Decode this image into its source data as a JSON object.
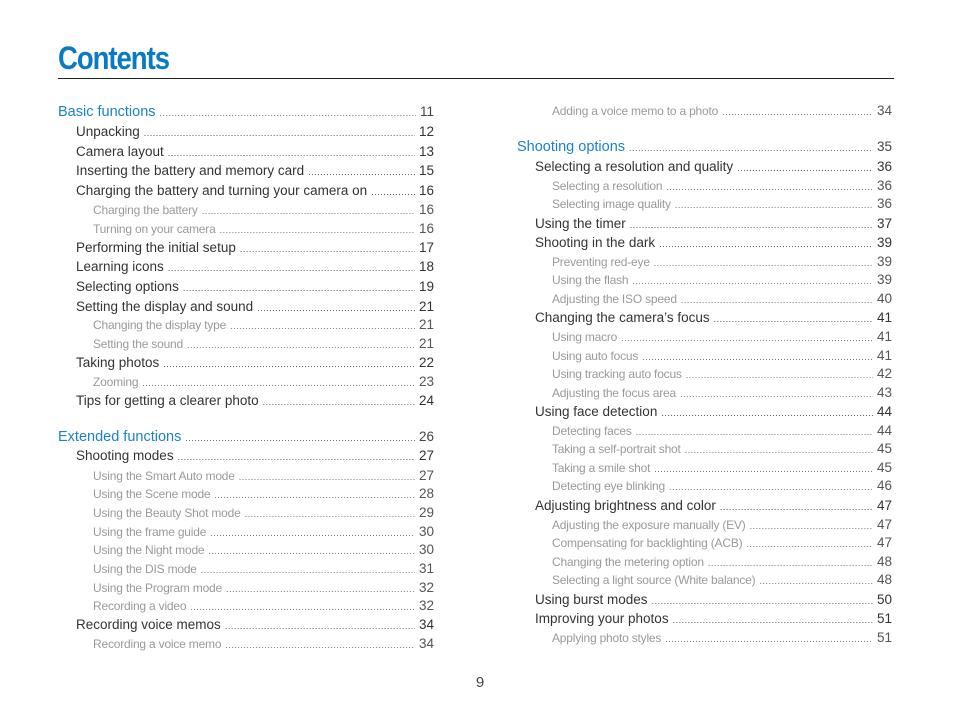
{
  "document": {
    "title": "Contents",
    "page_number": "9",
    "accent_color": "#1a82c8"
  },
  "toc": {
    "left": [
      {
        "level": 1,
        "label": "Basic functions",
        "page": "11"
      },
      {
        "level": 2,
        "label": "Unpacking",
        "page": "12"
      },
      {
        "level": 2,
        "label": "Camera layout",
        "page": "13"
      },
      {
        "level": 2,
        "label": "Inserting the battery and memory card",
        "page": "15"
      },
      {
        "level": 2,
        "label": "Charging the battery and turning your camera on",
        "page": "16"
      },
      {
        "level": 3,
        "label": "Charging the battery",
        "page": "16"
      },
      {
        "level": 3,
        "label": "Turning on your camera",
        "page": "16"
      },
      {
        "level": 2,
        "label": "Performing the initial setup",
        "page": "17"
      },
      {
        "level": 2,
        "label": "Learning icons",
        "page": "18"
      },
      {
        "level": 2,
        "label": "Selecting options",
        "page": "19"
      },
      {
        "level": 2,
        "label": "Setting the display and sound",
        "page": "21"
      },
      {
        "level": 3,
        "label": "Changing the display type",
        "page": "21"
      },
      {
        "level": 3,
        "label": "Setting the sound",
        "page": "21"
      },
      {
        "level": 2,
        "label": "Taking photos",
        "page": "22"
      },
      {
        "level": 3,
        "label": "Zooming",
        "page": "23"
      },
      {
        "level": 2,
        "label": "Tips for getting a clearer photo",
        "page": "24"
      },
      {
        "level": 1,
        "label": "Extended functions",
        "page": "26"
      },
      {
        "level": 2,
        "label": "Shooting modes",
        "page": "27"
      },
      {
        "level": 3,
        "label": "Using the Smart Auto mode",
        "page": "27"
      },
      {
        "level": 3,
        "label": "Using the Scene mode",
        "page": "28"
      },
      {
        "level": 3,
        "label": "Using the Beauty Shot mode",
        "page": "29"
      },
      {
        "level": 3,
        "label": "Using the frame guide",
        "page": "30"
      },
      {
        "level": 3,
        "label": "Using the Night mode",
        "page": "30"
      },
      {
        "level": 3,
        "label": "Using the DIS mode",
        "page": "31"
      },
      {
        "level": 3,
        "label": "Using the Program mode",
        "page": "32"
      },
      {
        "level": 3,
        "label": "Recording a video",
        "page": "32"
      },
      {
        "level": 2,
        "label": "Recording voice memos",
        "page": "34"
      },
      {
        "level": 3,
        "label": "Recording a voice memo",
        "page": "34"
      }
    ],
    "right": [
      {
        "level": 3,
        "label": "Adding a voice memo to a photo",
        "page": "34"
      },
      {
        "level": 1,
        "label": "Shooting options",
        "page": "35"
      },
      {
        "level": 2,
        "label": "Selecting a resolution and quality",
        "page": "36"
      },
      {
        "level": 3,
        "label": "Selecting a resolution",
        "page": "36"
      },
      {
        "level": 3,
        "label": "Selecting image quality",
        "page": "36"
      },
      {
        "level": 2,
        "label": "Using the timer",
        "page": "37"
      },
      {
        "level": 2,
        "label": "Shooting in the dark",
        "page": "39"
      },
      {
        "level": 3,
        "label": "Preventing red-eye",
        "page": "39"
      },
      {
        "level": 3,
        "label": "Using the flash",
        "page": "39"
      },
      {
        "level": 3,
        "label": "Adjusting the ISO speed",
        "page": "40"
      },
      {
        "level": 2,
        "label": "Changing the camera’s focus",
        "page": "41"
      },
      {
        "level": 3,
        "label": "Using macro",
        "page": "41"
      },
      {
        "level": 3,
        "label": "Using auto focus",
        "page": "41"
      },
      {
        "level": 3,
        "label": "Using tracking auto focus",
        "page": "42"
      },
      {
        "level": 3,
        "label": "Adjusting the focus area",
        "page": "43"
      },
      {
        "level": 2,
        "label": "Using face detection",
        "page": "44"
      },
      {
        "level": 3,
        "label": "Detecting faces",
        "page": "44"
      },
      {
        "level": 3,
        "label": "Taking a self-portrait shot",
        "page": "45"
      },
      {
        "level": 3,
        "label": "Taking a smile shot",
        "page": "45"
      },
      {
        "level": 3,
        "label": "Detecting eye blinking",
        "page": "46"
      },
      {
        "level": 2,
        "label": "Adjusting brightness and color",
        "page": "47"
      },
      {
        "level": 3,
        "label": "Adjusting the exposure manually (EV)",
        "page": "47"
      },
      {
        "level": 3,
        "label": "Compensating for backlighting (ACB)",
        "page": "47"
      },
      {
        "level": 3,
        "label": "Changing the metering option",
        "page": "48"
      },
      {
        "level": 3,
        "label": "Selecting a light source (White balance)",
        "page": "48"
      },
      {
        "level": 2,
        "label": "Using burst modes",
        "page": "50"
      },
      {
        "level": 2,
        "label": "Improving your photos",
        "page": "51"
      },
      {
        "level": 3,
        "label": "Applying photo styles",
        "page": "51"
      }
    ]
  }
}
